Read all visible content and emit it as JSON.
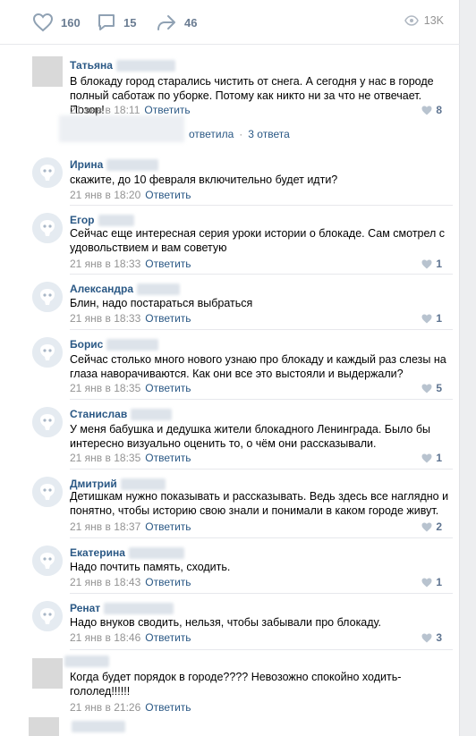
{
  "actions": {
    "likes": "160",
    "comments": "15",
    "shares": "46",
    "views": "13K"
  },
  "comments": [
    {
      "author": "Татьяна",
      "text": "В блокаду город старались чистить от снега. А сегодня у нас в городе полный саботаж по уборке. Потому как никто ни за что не отвечает. Позор!",
      "date": "21 янв в 18:11",
      "reply": "Ответить",
      "likes": "8"
    },
    {
      "author": "Ирина",
      "text": "скажите, до 10 февраля включительно будет идти?",
      "date": "21 янв в 18:20",
      "reply": "Ответить",
      "likes": ""
    },
    {
      "author": "Егор",
      "text": "Сейчас еще интересная серия уроки истории о блокаде. Сам смотрел с удовольствием и вам советую",
      "date": "21 янв в 18:33",
      "reply": "Ответить",
      "likes": "1"
    },
    {
      "author": "Александра",
      "text": "Блин, надо постараться выбраться",
      "date": "21 янв в 18:33",
      "reply": "Ответить",
      "likes": "1"
    },
    {
      "author": "Борис",
      "text": "Сейчас столько много нового узнаю про блокаду и каждый раз слезы на глаза наворачиваются. Как они все это выстояли и выдержали?",
      "date": "21 янв в 18:35",
      "reply": "Ответить",
      "likes": "5"
    },
    {
      "author": "Станислав",
      "text": "У меня бабушка и дедушка жители блокадного Ленинграда. Было бы интересно визуально оценить то, о чём они рассказывали.",
      "date": "21 янв в 18:35",
      "reply": "Ответить",
      "likes": "1"
    },
    {
      "author": "Дмитрий",
      "text": "Детишкам нужно показывать и рассказывать. Ведь здесь все наглядно и понятно, чтобы историю свою знали и понимали в каком городе живут.",
      "date": "21 янв в 18:37",
      "reply": "Ответить",
      "likes": "2"
    },
    {
      "author": "Екатерина",
      "text": "Надо почтить память, сходить.",
      "date": "21 янв в 18:43",
      "reply": "Ответить",
      "likes": "1"
    },
    {
      "author": "Ренат",
      "text": "Надо внуков сводить, нельзя, чтобы забывали про блокаду.",
      "date": "21 янв в 18:46",
      "reply": "Ответить",
      "likes": "3"
    },
    {
      "author": "",
      "text": "Когда будет порядок в городе???? Невозожно спокойно ходить- гололед!!!!!!",
      "date": "21 янв в 21:26",
      "reply": "Ответить",
      "likes": ""
    }
  ],
  "thread": {
    "answered": "ответила",
    "replies": "3 ответа"
  },
  "colors": {
    "link": "#2a5885",
    "muted": "#939393",
    "icon": "#6a7c92"
  }
}
